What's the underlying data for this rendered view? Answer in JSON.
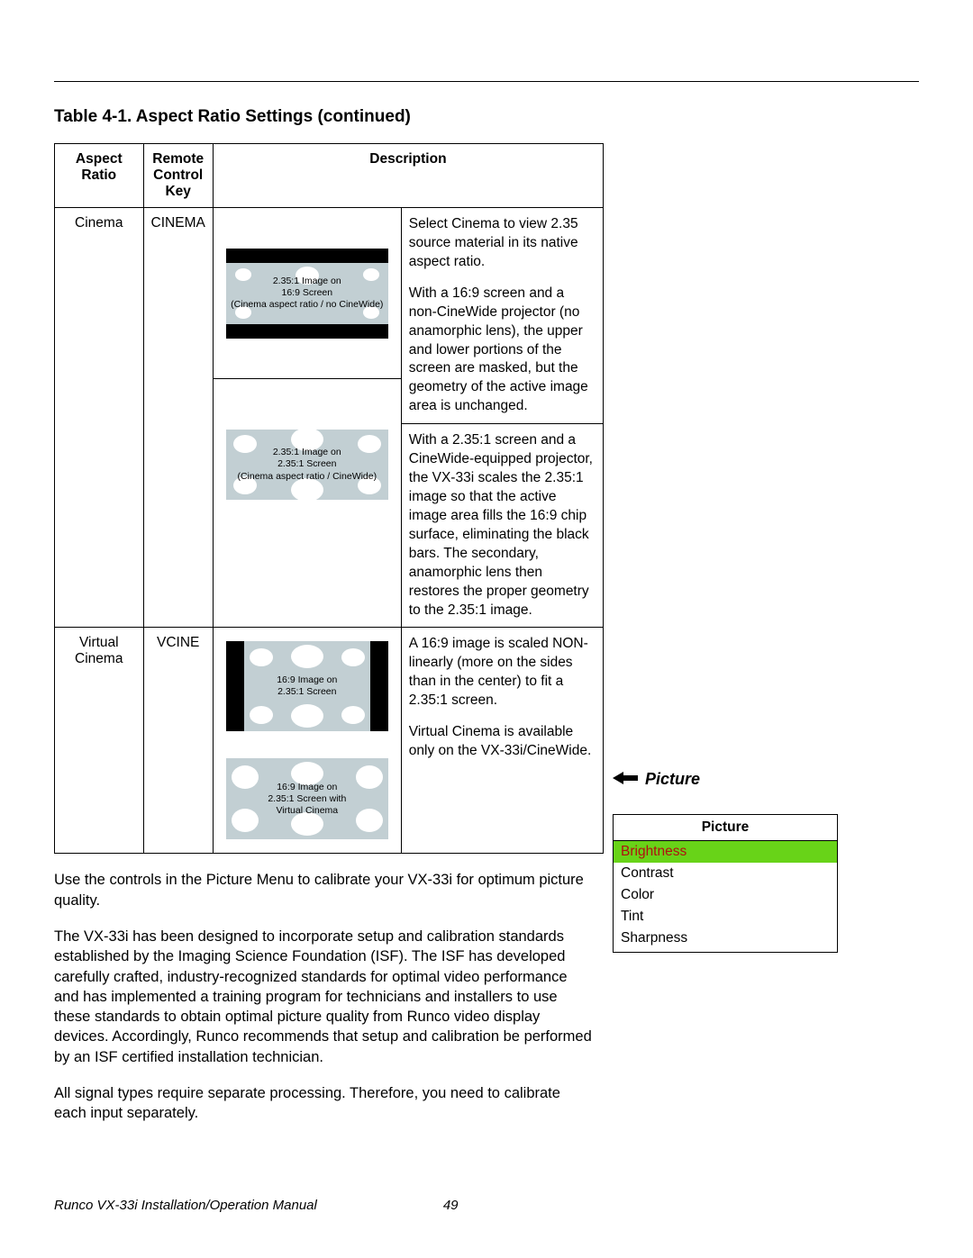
{
  "title": "Table 4-1. Aspect Ratio Settings (continued)",
  "headers": {
    "aspect": "Aspect Ratio",
    "key": "Remote Control Key",
    "desc": "Description"
  },
  "rows": {
    "cinema": {
      "aspect": "Cinema",
      "key": "CINEMA",
      "diag1": {
        "l1": "2.35:1 Image on",
        "l2": "16:9 Screen",
        "l3": "(Cinema aspect ratio / no CineWide)"
      },
      "diag2": {
        "l1": "2.35:1 Image on",
        "l2": "2.35:1 Screen",
        "l3": "(Cinema aspect ratio / CineWide)"
      },
      "desc1a": "Select Cinema to view 2.35 source material in its native aspect ratio.",
      "desc1b": "With a 16:9 screen and a non-CineWide projector (no anamorphic lens), the upper and lower portions of the screen are masked, but the geometry of the active image area is unchanged.",
      "desc2": "With a 2.35:1 screen and a CineWide-equipped projector, the VX-33i scales the 2.35:1 image so that the active image area fills the 16:9 chip surface, eliminating the black bars. The secondary, anamorphic lens then restores the proper geometry to the 2.35:1 image."
    },
    "vcinema": {
      "aspect": "Virtual Cinema",
      "key": "VCINE",
      "diag1": {
        "l1": "16:9 Image on",
        "l2": "2.35:1 Screen"
      },
      "diag2": {
        "l1": "16:9 Image on",
        "l2": "2.35:1 Screen with",
        "l3": "Virtual Cinema"
      },
      "desc1": "A 16:9 image is scaled NON-linearly (more on the sides than in the center) to fit a 2.35:1 screen.",
      "desc2": "Virtual Cinema is available only on the VX-33i/CineWide."
    }
  },
  "paragraphs": {
    "p1": "Use the controls in the Picture Menu to calibrate your VX-33i for optimum picture quality.",
    "p2": "The VX-33i has been designed to incorporate setup and calibration standards established by the Imaging Science Foundation (ISF). The ISF has developed carefully crafted, industry-recognized standards for optimal video performance and has implemented a training program for technicians and installers to use these standards to obtain optimal picture quality from Runco video display devices. Accordingly, Runco recommends that setup and calibration be performed by an ISF certified installation technician.",
    "p3": "All signal types require separate processing. Therefore, you need to calibrate each input separately."
  },
  "picture": {
    "section": "Picture",
    "header": "Picture",
    "items": [
      "Brightness",
      "Contrast",
      "Color",
      "Tint",
      "Sharpness"
    ]
  },
  "footer": {
    "doc": "Runco VX-33i Installation/Operation Manual",
    "page": "49"
  }
}
